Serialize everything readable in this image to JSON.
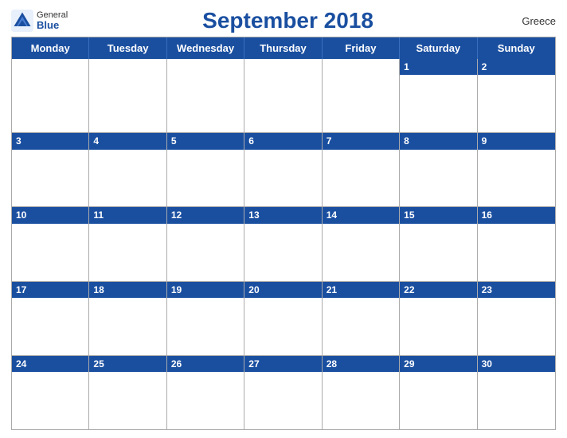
{
  "header": {
    "title": "September 2018",
    "country": "Greece",
    "logo": {
      "general": "General",
      "blue": "Blue"
    }
  },
  "weekdays": [
    "Monday",
    "Tuesday",
    "Wednesday",
    "Thursday",
    "Friday",
    "Saturday",
    "Sunday"
  ],
  "weeks": [
    [
      {
        "num": "",
        "empty": true
      },
      {
        "num": "",
        "empty": true
      },
      {
        "num": "",
        "empty": true
      },
      {
        "num": "",
        "empty": true
      },
      {
        "num": "",
        "empty": true
      },
      {
        "num": "1",
        "empty": false
      },
      {
        "num": "2",
        "empty": false
      }
    ],
    [
      {
        "num": "3",
        "empty": false
      },
      {
        "num": "4",
        "empty": false
      },
      {
        "num": "5",
        "empty": false
      },
      {
        "num": "6",
        "empty": false
      },
      {
        "num": "7",
        "empty": false
      },
      {
        "num": "8",
        "empty": false
      },
      {
        "num": "9",
        "empty": false
      }
    ],
    [
      {
        "num": "10",
        "empty": false
      },
      {
        "num": "11",
        "empty": false
      },
      {
        "num": "12",
        "empty": false
      },
      {
        "num": "13",
        "empty": false
      },
      {
        "num": "14",
        "empty": false
      },
      {
        "num": "15",
        "empty": false
      },
      {
        "num": "16",
        "empty": false
      }
    ],
    [
      {
        "num": "17",
        "empty": false
      },
      {
        "num": "18",
        "empty": false
      },
      {
        "num": "19",
        "empty": false
      },
      {
        "num": "20",
        "empty": false
      },
      {
        "num": "21",
        "empty": false
      },
      {
        "num": "22",
        "empty": false
      },
      {
        "num": "23",
        "empty": false
      }
    ],
    [
      {
        "num": "24",
        "empty": false
      },
      {
        "num": "25",
        "empty": false
      },
      {
        "num": "26",
        "empty": false
      },
      {
        "num": "27",
        "empty": false
      },
      {
        "num": "28",
        "empty": false
      },
      {
        "num": "29",
        "empty": false
      },
      {
        "num": "30",
        "empty": false
      }
    ]
  ]
}
